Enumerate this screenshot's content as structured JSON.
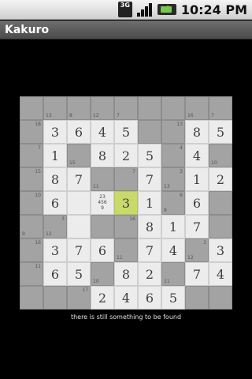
{
  "status": {
    "network": "3G",
    "time": "10:24 PM"
  },
  "app": {
    "title": "Kakuro"
  },
  "board": {
    "rows": [
      [
        {
          "t": "b"
        },
        {
          "t": "b",
          "d": "13"
        },
        {
          "t": "b",
          "d": "8"
        },
        {
          "t": "b",
          "d": "12"
        },
        {
          "t": "b",
          "d": "7"
        },
        {
          "t": "b"
        },
        {
          "t": "b"
        },
        {
          "t": "b",
          "d": "16"
        },
        {
          "t": "b",
          "d": "7"
        }
      ],
      [
        {
          "t": "b",
          "r": "18"
        },
        {
          "t": "w",
          "v": "3"
        },
        {
          "t": "w",
          "v": "6"
        },
        {
          "t": "w",
          "v": "4"
        },
        {
          "t": "w",
          "v": "5"
        },
        {
          "t": "b"
        },
        {
          "t": "b",
          "r": "13"
        },
        {
          "t": "w",
          "v": "8"
        },
        {
          "t": "w",
          "v": "5"
        }
      ],
      [
        {
          "t": "b",
          "r": "7"
        },
        {
          "t": "w",
          "v": "1"
        },
        {
          "t": "b",
          "d": "15"
        },
        {
          "t": "w",
          "v": "8"
        },
        {
          "t": "w",
          "v": "2"
        },
        {
          "t": "w",
          "v": "5"
        },
        {
          "t": "b",
          "r": "4"
        },
        {
          "t": "w",
          "v": "4"
        },
        {
          "t": "b",
          "d": "10"
        }
      ],
      [
        {
          "t": "b",
          "r": "15"
        },
        {
          "t": "w",
          "v": "8"
        },
        {
          "t": "w",
          "v": "7"
        },
        {
          "t": "b",
          "d": "11"
        },
        {
          "t": "b",
          "r": "7"
        },
        {
          "t": "w",
          "v": "7"
        },
        {
          "t": "b",
          "d": "13",
          "r": "3"
        },
        {
          "t": "w",
          "v": "1"
        },
        {
          "t": "w",
          "v": "2"
        }
      ],
      [
        {
          "t": "b",
          "r": "10"
        },
        {
          "t": "w",
          "v": "6"
        },
        {
          "t": "w",
          "v": ""
        },
        {
          "t": "w",
          "notes": [
            "23",
            "456",
            "9"
          ]
        },
        {
          "t": "s",
          "v": "3"
        },
        {
          "t": "w",
          "v": "1"
        },
        {
          "t": "b",
          "d": "9",
          "r": "6"
        },
        {
          "t": "w",
          "v": "6"
        },
        {
          "t": "b"
        }
      ],
      [
        {
          "t": "b",
          "d": "9"
        },
        {
          "t": "b",
          "d": "12",
          "r": "3"
        },
        {
          "t": "w",
          "v": ""
        },
        {
          "t": "b"
        },
        {
          "t": "b",
          "r": "16"
        },
        {
          "t": "w",
          "v": "8"
        },
        {
          "t": "w",
          "v": "1"
        },
        {
          "t": "w",
          "v": "7"
        },
        {
          "t": "b"
        }
      ],
      [
        {
          "t": "b",
          "r": "16"
        },
        {
          "t": "w",
          "v": "3"
        },
        {
          "t": "w",
          "v": "7"
        },
        {
          "t": "w",
          "v": "6"
        },
        {
          "t": "b",
          "d": "11"
        },
        {
          "t": "w",
          "v": "7"
        },
        {
          "t": "w",
          "v": "4"
        },
        {
          "t": "b",
          "d": "12",
          "r": "3"
        },
        {
          "t": "w",
          "v": "3"
        }
      ],
      [
        {
          "t": "b",
          "r": "11"
        },
        {
          "t": "w",
          "v": "6"
        },
        {
          "t": "w",
          "v": "5"
        },
        {
          "t": "b",
          "d": "10"
        },
        {
          "t": "w",
          "v": "8"
        },
        {
          "t": "w",
          "v": "2"
        },
        {
          "t": "b",
          "d": "11"
        },
        {
          "t": "w",
          "v": "7"
        },
        {
          "t": "w",
          "v": "4"
        }
      ],
      [
        {
          "t": "b"
        },
        {
          "t": "b"
        },
        {
          "t": "b",
          "r": "17"
        },
        {
          "t": "w",
          "v": "2"
        },
        {
          "t": "w",
          "v": "4"
        },
        {
          "t": "w",
          "v": "6"
        },
        {
          "t": "w",
          "v": "5"
        },
        {
          "t": "b"
        },
        {
          "t": "b"
        }
      ]
    ]
  },
  "hint": "there is still something to be found"
}
